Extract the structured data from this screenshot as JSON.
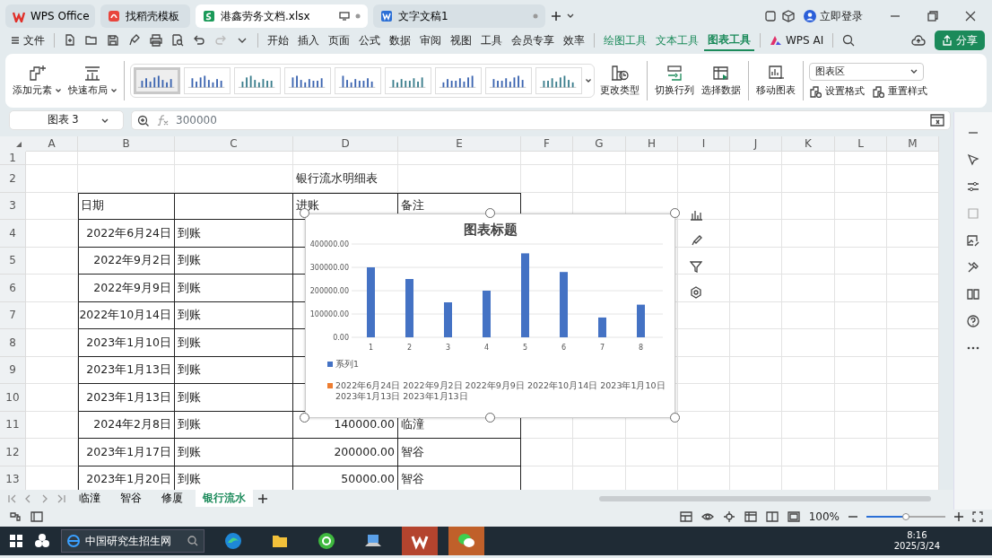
{
  "tabs": [
    {
      "label": "WPS Office",
      "kind": "wps",
      "selected": false
    },
    {
      "label": "找稻壳模板",
      "kind": "template",
      "selected": false
    },
    {
      "label": "港鑫劳务文档.xlsx",
      "kind": "sheet",
      "selected": true
    },
    {
      "label": "文字文稿1",
      "kind": "writer",
      "selected": false
    }
  ],
  "account": {
    "label": "立即登录"
  },
  "menu": {
    "file": "文件",
    "items": [
      {
        "label": "开始",
        "kind": "plain",
        "selected": false
      },
      {
        "label": "插入",
        "kind": "plain",
        "selected": false
      },
      {
        "label": "页面",
        "kind": "plain",
        "selected": false
      },
      {
        "label": "公式",
        "kind": "plain",
        "selected": false
      },
      {
        "label": "数据",
        "kind": "plain",
        "selected": false
      },
      {
        "label": "审阅",
        "kind": "plain",
        "selected": false
      },
      {
        "label": "视图",
        "kind": "plain",
        "selected": false
      },
      {
        "label": "工具",
        "kind": "plain",
        "selected": false
      },
      {
        "label": "会员专享",
        "kind": "plain",
        "selected": false
      },
      {
        "label": "效率",
        "kind": "plain",
        "selected": false
      },
      {
        "label": "绘图工具",
        "kind": "context",
        "selected": false
      },
      {
        "label": "文本工具",
        "kind": "context",
        "selected": false
      },
      {
        "label": "图表工具",
        "kind": "context",
        "selected": true
      }
    ],
    "ai": "WPS AI",
    "share": "分享"
  },
  "ribbon": {
    "left": [
      {
        "label": "添加元素",
        "kind": "add"
      },
      {
        "label": "快速布局",
        "kind": "layout"
      }
    ],
    "styles": [
      {
        "selected": true
      },
      {
        "selected": false
      },
      {
        "selected": false
      },
      {
        "selected": false
      },
      {
        "selected": false
      },
      {
        "selected": false
      },
      {
        "selected": false
      },
      {
        "selected": false
      },
      {
        "selected": false
      }
    ],
    "actions": [
      {
        "label": "更改类型",
        "kind": "type"
      },
      {
        "label": "切换行列",
        "kind": "switch"
      },
      {
        "label": "选择数据",
        "kind": "data"
      },
      {
        "label": "移动图表",
        "kind": "move"
      }
    ],
    "area_select": "图表区",
    "format_buttons": [
      {
        "label": "设置格式"
      },
      {
        "label": "重置样式"
      }
    ]
  },
  "formula_bar": {
    "name_box": "图表 3",
    "value": "300000"
  },
  "columns": [
    "A",
    "B",
    "C",
    "D",
    "E",
    "F",
    "G",
    "H",
    "I",
    "J",
    "K",
    "L",
    "M"
  ],
  "rows": [
    {
      "number": "1",
      "boxed": false
    },
    {
      "number": "2",
      "boxed": false,
      "cells": {
        "D": {
          "text": "银行流水明细表",
          "kind": "text"
        }
      }
    },
    {
      "number": "3",
      "boxed": true,
      "cells": {
        "B": {
          "text": "日期",
          "kind": "text"
        },
        "D": {
          "text": "进账",
          "kind": "text"
        },
        "E": {
          "text": "备注",
          "kind": "text"
        }
      }
    },
    {
      "number": "4",
      "boxed": true,
      "cells": {
        "B": {
          "text": "2022年6月24日",
          "kind": "number"
        },
        "C": {
          "text": "到账",
          "kind": "text"
        }
      }
    },
    {
      "number": "5",
      "boxed": true,
      "cells": {
        "B": {
          "text": "2022年9月2日",
          "kind": "number"
        },
        "C": {
          "text": "到账",
          "kind": "text"
        }
      }
    },
    {
      "number": "6",
      "boxed": true,
      "cells": {
        "B": {
          "text": "2022年9月9日",
          "kind": "number"
        },
        "C": {
          "text": "到账",
          "kind": "text"
        }
      }
    },
    {
      "number": "7",
      "boxed": true,
      "cells": {
        "B": {
          "text": "2022年10月14日",
          "kind": "number"
        },
        "C": {
          "text": "到账",
          "kind": "text"
        }
      }
    },
    {
      "number": "8",
      "boxed": true,
      "cells": {
        "B": {
          "text": "2023年1月10日",
          "kind": "number"
        },
        "C": {
          "text": "到账",
          "kind": "text"
        }
      }
    },
    {
      "number": "9",
      "boxed": true,
      "cells": {
        "B": {
          "text": "2023年1月13日",
          "kind": "number"
        },
        "C": {
          "text": "到账",
          "kind": "text"
        }
      }
    },
    {
      "number": "10",
      "boxed": true,
      "cells": {
        "B": {
          "text": "2023年1月13日",
          "kind": "number"
        },
        "C": {
          "text": "到账",
          "kind": "text"
        }
      }
    },
    {
      "number": "11",
      "boxed": true,
      "cells": {
        "B": {
          "text": "2024年2月8日",
          "kind": "number"
        },
        "C": {
          "text": "到账",
          "kind": "text"
        },
        "D": {
          "text": "140000.00",
          "kind": "number"
        },
        "E": {
          "text": "临潼",
          "kind": "text"
        }
      }
    },
    {
      "number": "12",
      "boxed": true,
      "cells": {
        "B": {
          "text": "2023年1月17日",
          "kind": "number"
        },
        "C": {
          "text": "到账",
          "kind": "text"
        },
        "D": {
          "text": "200000.00",
          "kind": "number"
        },
        "E": {
          "text": "智谷",
          "kind": "text"
        }
      }
    },
    {
      "number": "13",
      "boxed": true,
      "cells": {
        "B": {
          "text": "2023年1月20日",
          "kind": "number"
        },
        "C": {
          "text": "到账",
          "kind": "text"
        },
        "D": {
          "text": "50000.00",
          "kind": "number"
        },
        "E": {
          "text": "智谷",
          "kind": "text"
        }
      }
    }
  ],
  "chart": {
    "chart_data": {
      "type": "bar",
      "title": "图表标题",
      "categories": [
        "1",
        "2",
        "3",
        "4",
        "5",
        "6",
        "7",
        "8"
      ],
      "series": [
        {
          "name": "系列1",
          "color": "#4472c4",
          "values": [
            300000,
            250000,
            150000,
            200000,
            360000,
            280000,
            85000,
            140000
          ]
        },
        {
          "name": "2022年6月24日 2022年9月2日 2022年9月9日 2022年10月14日 2023年1月10日 2023年1月13日 2023年1月13日",
          "color": "#ed7d31",
          "values": [
            null,
            null,
            null,
            null,
            null,
            null,
            null,
            null
          ]
        }
      ],
      "grid": true,
      "ylim": [
        0,
        400000
      ],
      "yticks": [
        {
          "value": 0,
          "label": "0.00"
        },
        {
          "value": 100000,
          "label": "100000.00"
        },
        {
          "value": 200000,
          "label": "200000.00"
        },
        {
          "value": 300000,
          "label": "300000.00"
        },
        {
          "value": 400000,
          "label": "400000.00"
        }
      ]
    }
  },
  "sheet_tabs": [
    {
      "label": "临潼",
      "selected": false
    },
    {
      "label": "智谷",
      "selected": false
    },
    {
      "label": "修厦",
      "selected": false
    },
    {
      "label": "银行流水",
      "selected": true
    }
  ],
  "status_bar": {
    "zoom": "100%",
    "zoom_slider": {
      "level": 0.5
    }
  },
  "taskbar": {
    "search": "中国研究生招生网",
    "apps": [
      {
        "kind": "edge",
        "active": false
      },
      {
        "kind": "folder",
        "active": false
      },
      {
        "kind": "green",
        "active": false
      },
      {
        "kind": "computer",
        "active": false
      },
      {
        "kind": "wps",
        "active": true
      },
      {
        "kind": "chat",
        "active": true
      }
    ],
    "time": "8:16",
    "date": "2025/3/24"
  }
}
